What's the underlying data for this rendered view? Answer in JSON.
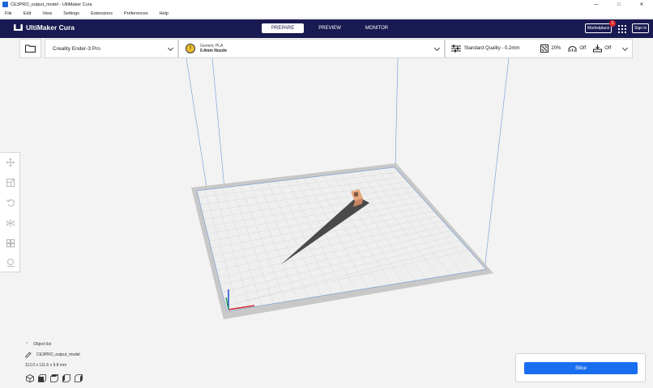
{
  "window": {
    "title": "CE3PRO_output_model - UltiMaker Cura",
    "controls": {
      "minimize": "—",
      "maximize": "□",
      "close": "✕"
    }
  },
  "menu": {
    "items": [
      "File",
      "Edit",
      "View",
      "Settings",
      "Extensions",
      "Preferences",
      "Help"
    ]
  },
  "header": {
    "app_name": "UltiMaker Cura",
    "tabs": [
      "PREPARE",
      "PREVIEW",
      "MONITOR"
    ],
    "active_tab": "PREPARE",
    "marketplace_label": "Marketplace",
    "marketplace_badge": "1",
    "signin_label": "Sign in",
    "colors": {
      "header_bg": "#1a1a52",
      "accent": "#196ef0",
      "badge": "#d9262b"
    }
  },
  "printer": {
    "name": "Creality Ender-3 Pro"
  },
  "material": {
    "icon_text": "!",
    "name": "Generic PLA",
    "nozzle": "0.4mm Nozzle"
  },
  "quality": {
    "profile": "Standard Quality - 0.2mm",
    "infill": "20%",
    "support": "Off",
    "adhesion": "Off"
  },
  "tools": {
    "icons": [
      "move-icon",
      "scale-icon",
      "rotate-icon",
      "mirror-icon",
      "per-model-settings-icon",
      "support-blocker-icon"
    ]
  },
  "objects": {
    "list_label": "Object list",
    "model_name": "CE3PRO_output_model",
    "dimensions": "112.0 x 111.6 x 9.8 mm"
  },
  "view_buttons": [
    "3d-view-icon",
    "front-view-icon",
    "top-view-icon",
    "left-view-icon",
    "right-view-icon"
  ],
  "slice": {
    "label": "Slice"
  }
}
